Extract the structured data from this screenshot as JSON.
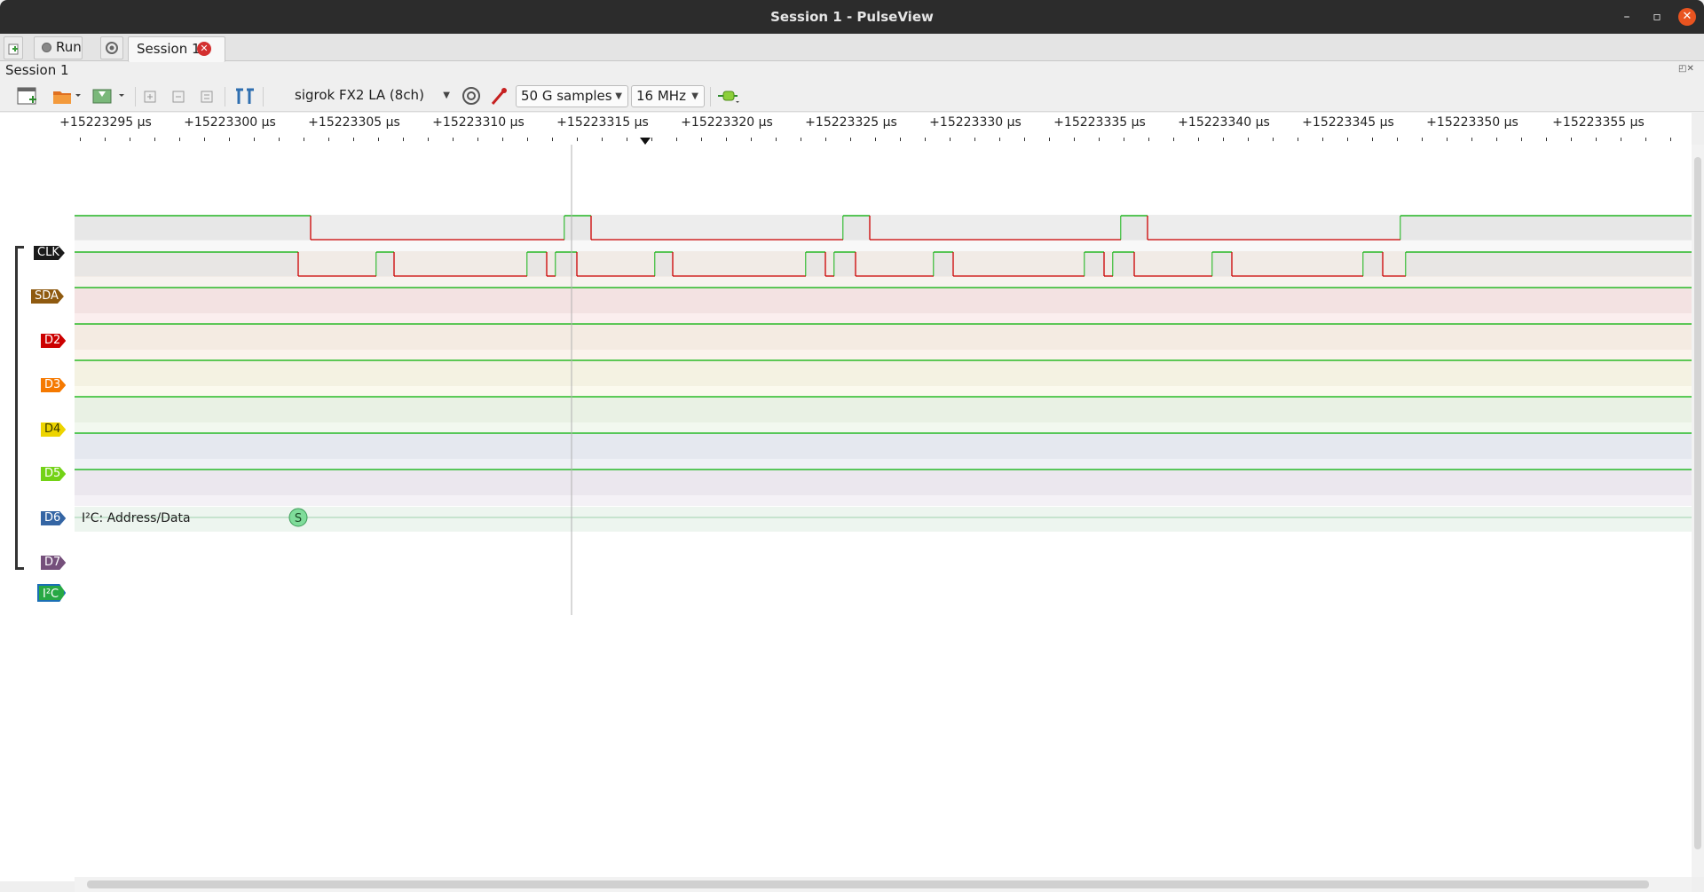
{
  "window": {
    "title": "Session 1 - PulseView",
    "minimize": "–",
    "maximize": "▫",
    "close": "✕"
  },
  "tabs": {
    "new_session_icon": "new-session-icon",
    "run_label": "Run",
    "session_tab_label": "Session 1",
    "close_glyph": "✕"
  },
  "session": {
    "label": "Session 1",
    "dock_glyphs": "◰✕"
  },
  "toolbar": {
    "device": "sigrok FX2 LA (8ch)",
    "samples": "50 G samples",
    "samplerate": "16 MHz"
  },
  "ruler": {
    "ticks": [
      "+15223295 µs",
      "+15223300 µs",
      "+15223305 µs",
      "+15223310 µs",
      "+15223315 µs",
      "+15223320 µs",
      "+15223325 µs",
      "+15223330 µs",
      "+15223335 µs",
      "+15223340 µs",
      "+15223345 µs",
      "+15223350 µs",
      "+15223355 µs"
    ]
  },
  "channels": [
    {
      "name": "CLK",
      "color": "#1a1a1a"
    },
    {
      "name": "SDA",
      "color": "#8f5a10"
    },
    {
      "name": "D2",
      "color": "#cc0000"
    },
    {
      "name": "D3",
      "color": "#f57900"
    },
    {
      "name": "D4",
      "color": "#edd400"
    },
    {
      "name": "D5",
      "color": "#73d216"
    },
    {
      "name": "D6",
      "color": "#3465a4"
    },
    {
      "name": "D7",
      "color": "#75507b"
    }
  ],
  "decoder": {
    "label": "I²C",
    "row_title": "I²C: Address/Data",
    "start_marker": "S",
    "color": "#27a844"
  },
  "colors": {
    "high": "#00b000",
    "low": "#cc0000",
    "bg": "#ffffff"
  }
}
